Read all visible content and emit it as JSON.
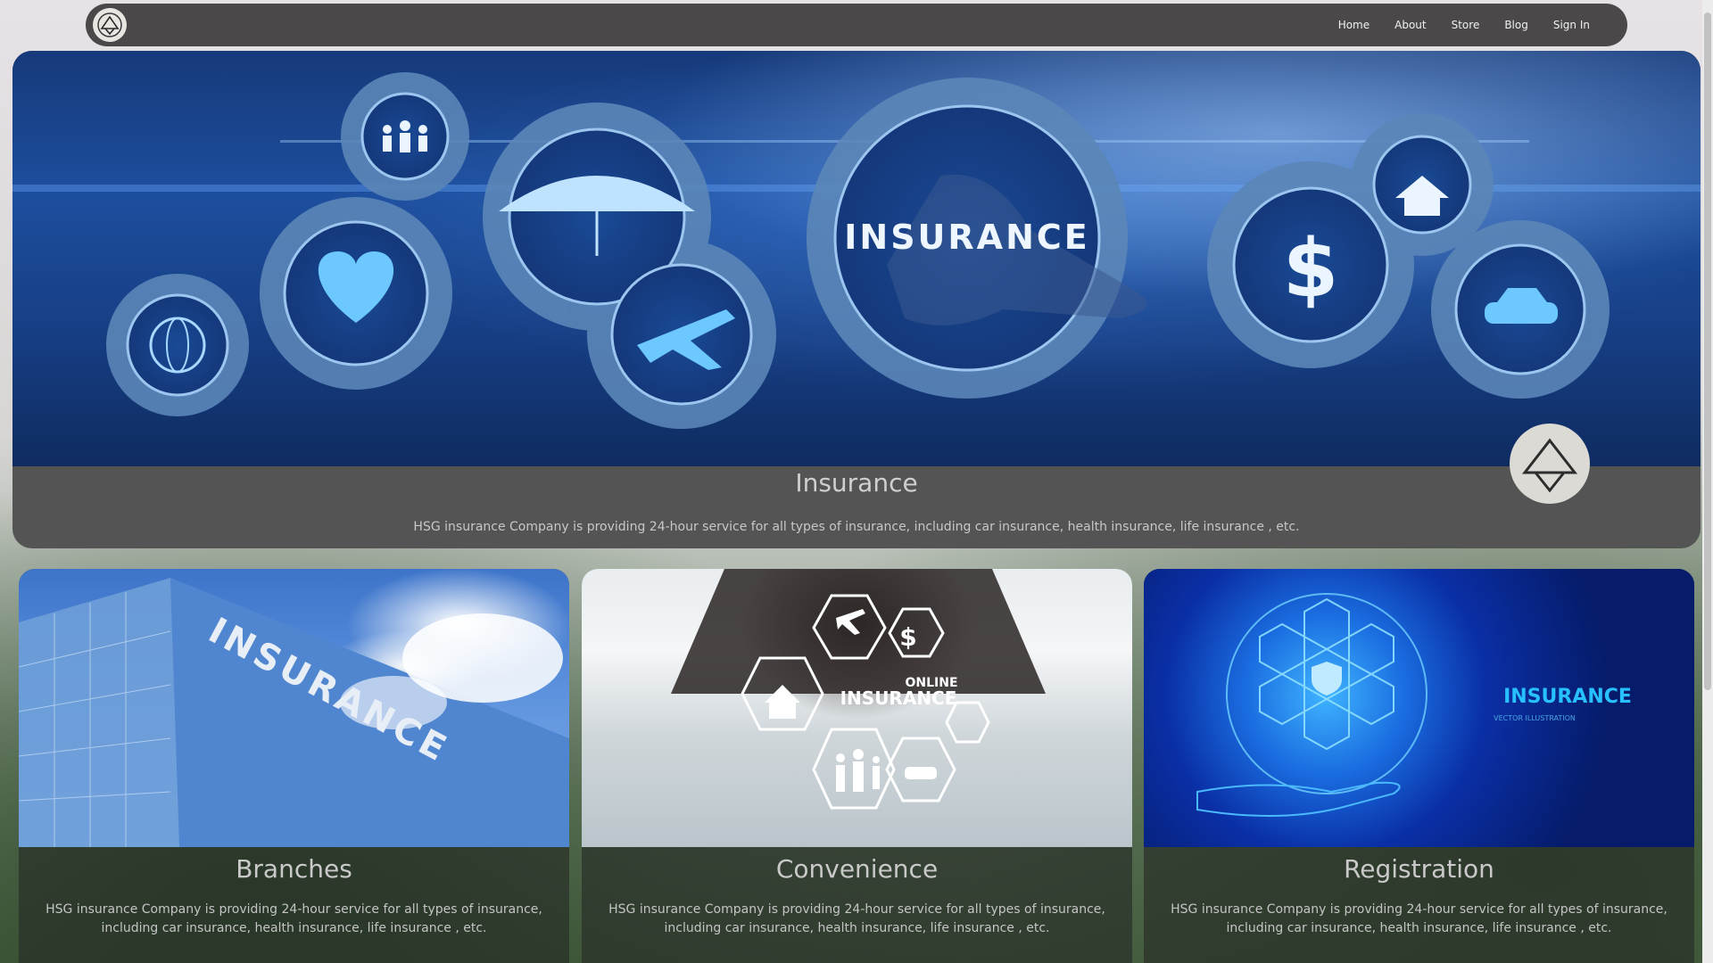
{
  "nav": {
    "logo_icon": "triangle-logo-icon",
    "links": [
      {
        "label": "Home"
      },
      {
        "label": "About"
      },
      {
        "label": "Store"
      },
      {
        "label": "Blog"
      },
      {
        "label": "Sign In"
      }
    ]
  },
  "hero": {
    "image_text": "INSURANCE",
    "badge_icon": "triangle-logo-icon",
    "title": "Insurance",
    "description": "HSG insurance Company is providing 24-hour service for all types of insurance, including car insurance, health insurance, life insurance , etc."
  },
  "cards": [
    {
      "image_text": "INSURANCE",
      "title": "Branches",
      "description": "HSG insurance Company is providing 24-hour service for all types of insurance, including car insurance, health insurance, life insurance , etc."
    },
    {
      "image_text_1": "ONLINE",
      "image_text_2": "INSURANCE",
      "title": "Convenience",
      "description": "HSG insurance Company is providing 24-hour service for all types of insurance, including car insurance, health insurance, life insurance , etc."
    },
    {
      "image_text_1": "INSURANCE",
      "image_text_2": "VECTOR ILLUSTRATION",
      "title": "Registration",
      "description": "HSG insurance Company is providing 24-hour service for all types of insurance, including car insurance, health insurance, life insurance , etc."
    }
  ],
  "colors": {
    "navbar": "#4a4849",
    "hero_panel": "#545454",
    "accent_blue": "#1d4e9e",
    "text_light": "#cfcfcf"
  }
}
